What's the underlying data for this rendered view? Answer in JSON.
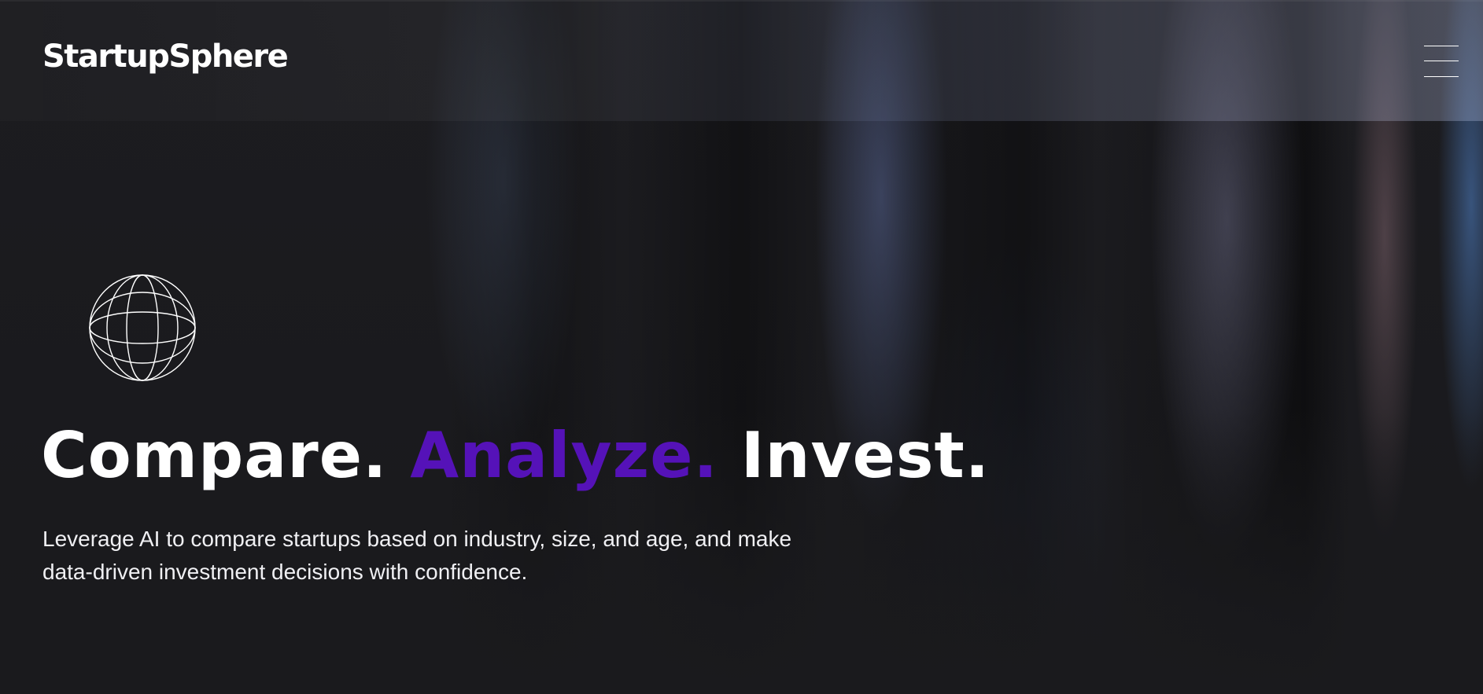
{
  "brand": {
    "name": "StartupSphere"
  },
  "header": {
    "menu_icon": "hamburger-menu-icon"
  },
  "hero": {
    "icon": "globe-icon",
    "headline": {
      "word1": "Compare.",
      "word2": "Analyze.",
      "word3": "Invest."
    },
    "subtitle": "Leverage AI to compare startups based on industry, size, and age, and make data-driven investment decisions with confidence."
  },
  "colors": {
    "background": "#1a1a1d",
    "accent": "#5512b8",
    "text": "#ffffff"
  }
}
